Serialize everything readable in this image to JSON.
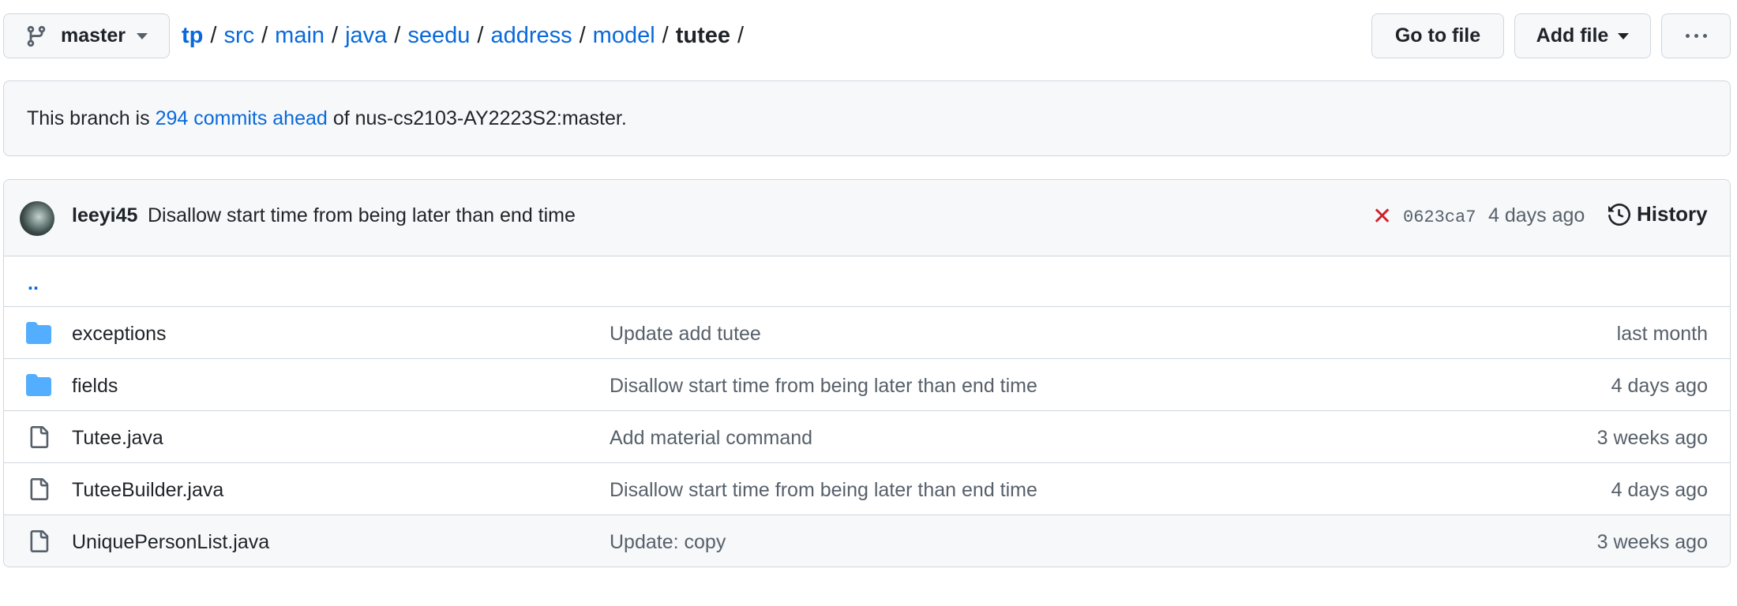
{
  "branch": {
    "name": "master"
  },
  "breadcrumb": {
    "links": [
      "tp",
      "src",
      "main",
      "java",
      "seedu",
      "address",
      "model"
    ],
    "current": "tutee",
    "separator": "/"
  },
  "header_buttons": {
    "go_to_file": "Go to file",
    "add_file": "Add file"
  },
  "notice": {
    "prefix": "This branch is",
    "link": "294 commits ahead",
    "suffix": "of nus-cs2103-AY2223S2:master."
  },
  "latest_commit": {
    "author": "leeyi45",
    "message": "Disallow start time from being later than end time",
    "status": "failed",
    "sha": "0623ca7",
    "age": "4 days ago",
    "history_label": "History"
  },
  "parent_link": "..",
  "files": [
    {
      "type": "folder",
      "name": "exceptions",
      "message": "Update add tutee",
      "age": "last month"
    },
    {
      "type": "folder",
      "name": "fields",
      "message": "Disallow start time from being later than end time",
      "age": "4 days ago"
    },
    {
      "type": "file",
      "name": "Tutee.java",
      "message": "Add material command",
      "age": "3 weeks ago"
    },
    {
      "type": "file",
      "name": "TuteeBuilder.java",
      "message": "Disallow start time from being later than end time",
      "age": "4 days ago"
    },
    {
      "type": "file",
      "name": "UniquePersonList.java",
      "message": "Update: copy",
      "age": "3 weeks ago"
    }
  ],
  "colors": {
    "link": "#0969da",
    "folder": "#54aeff",
    "fail": "#cf222e",
    "muted": "#57606a"
  }
}
